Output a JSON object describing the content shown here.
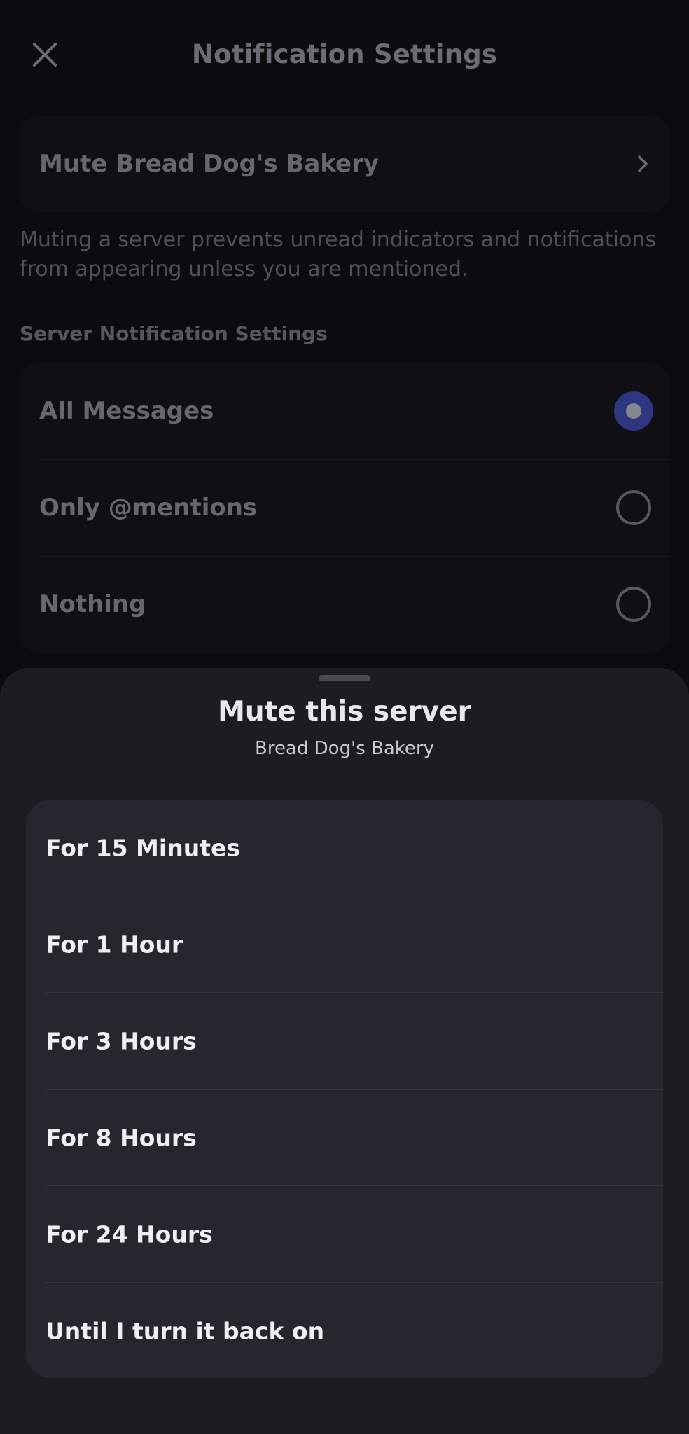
{
  "header": {
    "title": "Notification Settings",
    "close_icon": "close-icon"
  },
  "mute": {
    "label": "Mute Bread Dog's Bakery",
    "chevron_icon": "chevron-right-icon",
    "description": "Muting a server prevents unread indicators and notifications from appearing unless you are mentioned."
  },
  "server_notifications": {
    "section_title": "Server Notification Settings",
    "options": [
      {
        "label": "All Messages",
        "selected": true
      },
      {
        "label": "Only @mentions",
        "selected": false
      },
      {
        "label": "Nothing",
        "selected": false
      }
    ]
  },
  "sheet": {
    "title": "Mute this server",
    "subtitle": "Bread Dog's Bakery",
    "options": [
      {
        "label": "For 15 Minutes"
      },
      {
        "label": "For 1 Hour"
      },
      {
        "label": "For 3 Hours"
      },
      {
        "label": "For 8 Hours"
      },
      {
        "label": "For 24 Hours"
      },
      {
        "label": "Until I turn it back on"
      }
    ]
  },
  "colors": {
    "accent_selected": "#2f3680",
    "sheet_background": "#1c1d22",
    "sheet_card": "#25262e"
  }
}
